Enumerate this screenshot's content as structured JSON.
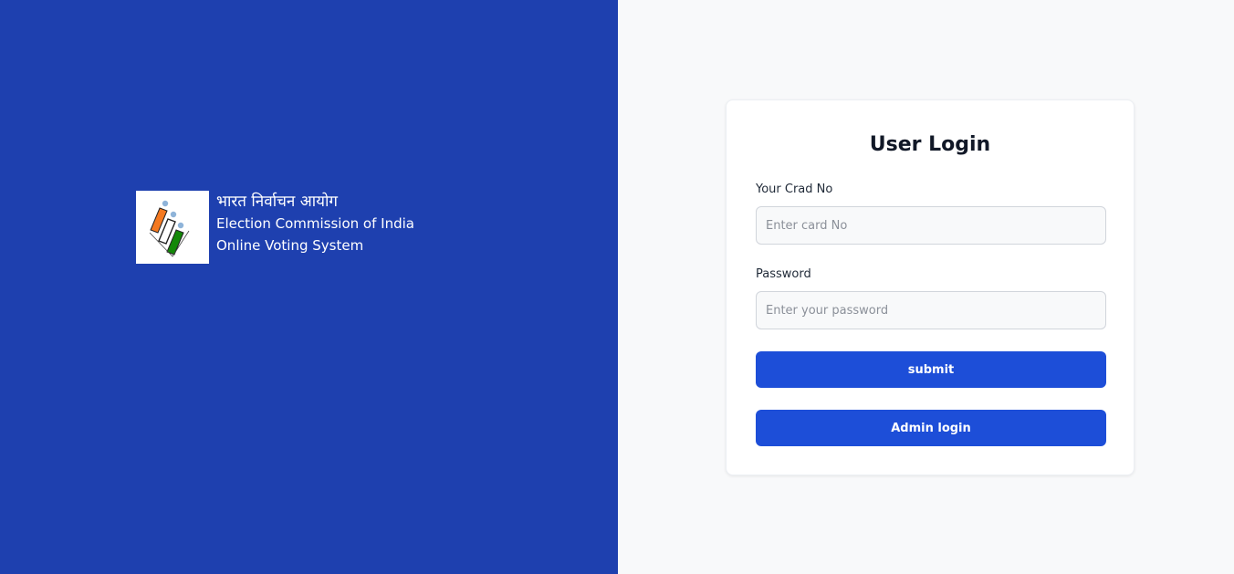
{
  "brand": {
    "hindi_name": "भारत निर्वाचन आयोग",
    "org_name": "Election Commission of India",
    "system_name": "Online Voting System",
    "logo_icon": "eci-ballot-logo-icon",
    "logo_colors": [
      "#f47920",
      "#ffffff",
      "#138808",
      "#8fb4d9"
    ]
  },
  "login": {
    "title": "User Login",
    "card_label": "Your Crad No",
    "card_placeholder": "Enter card No",
    "password_label": "Password",
    "password_placeholder": "Enter your password",
    "submit_label": "submit",
    "admin_label": "Admin login"
  },
  "colors": {
    "left_panel_bg": "#1e40af",
    "right_panel_bg": "#f8f9fa",
    "button_bg": "#1d4ed8",
    "title_text": "#111827"
  }
}
